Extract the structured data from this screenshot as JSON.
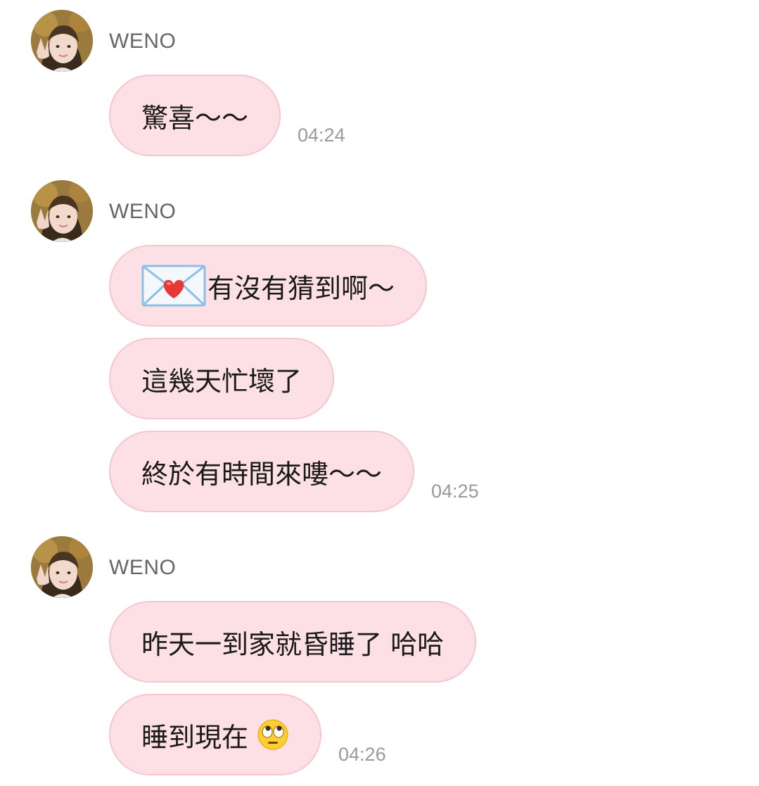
{
  "groups": [
    {
      "sender": "WENO",
      "messages": [
        {
          "text": "驚喜～～",
          "time": "04:24"
        }
      ]
    },
    {
      "sender": "WENO",
      "messages": [
        {
          "text": "有沒有猜到啊～",
          "icon": "love-letter-icon"
        },
        {
          "text": "這幾天忙壞了"
        },
        {
          "text": "終於有時間來嘍～～",
          "time": "04:25"
        }
      ]
    },
    {
      "sender": "WENO",
      "messages": [
        {
          "text": "昨天一到家就昏睡了 哈哈"
        },
        {
          "text": "睡到現在",
          "icon": "rolling-eyes-emoji-icon",
          "time": "04:26"
        }
      ]
    }
  ],
  "colors": {
    "bubble_fill": "#fde0e5",
    "bubble_border": "#f6c6d0",
    "sender_text": "#666666",
    "time_text": "#9a9a9a",
    "message_text": "#1a1a1a"
  }
}
